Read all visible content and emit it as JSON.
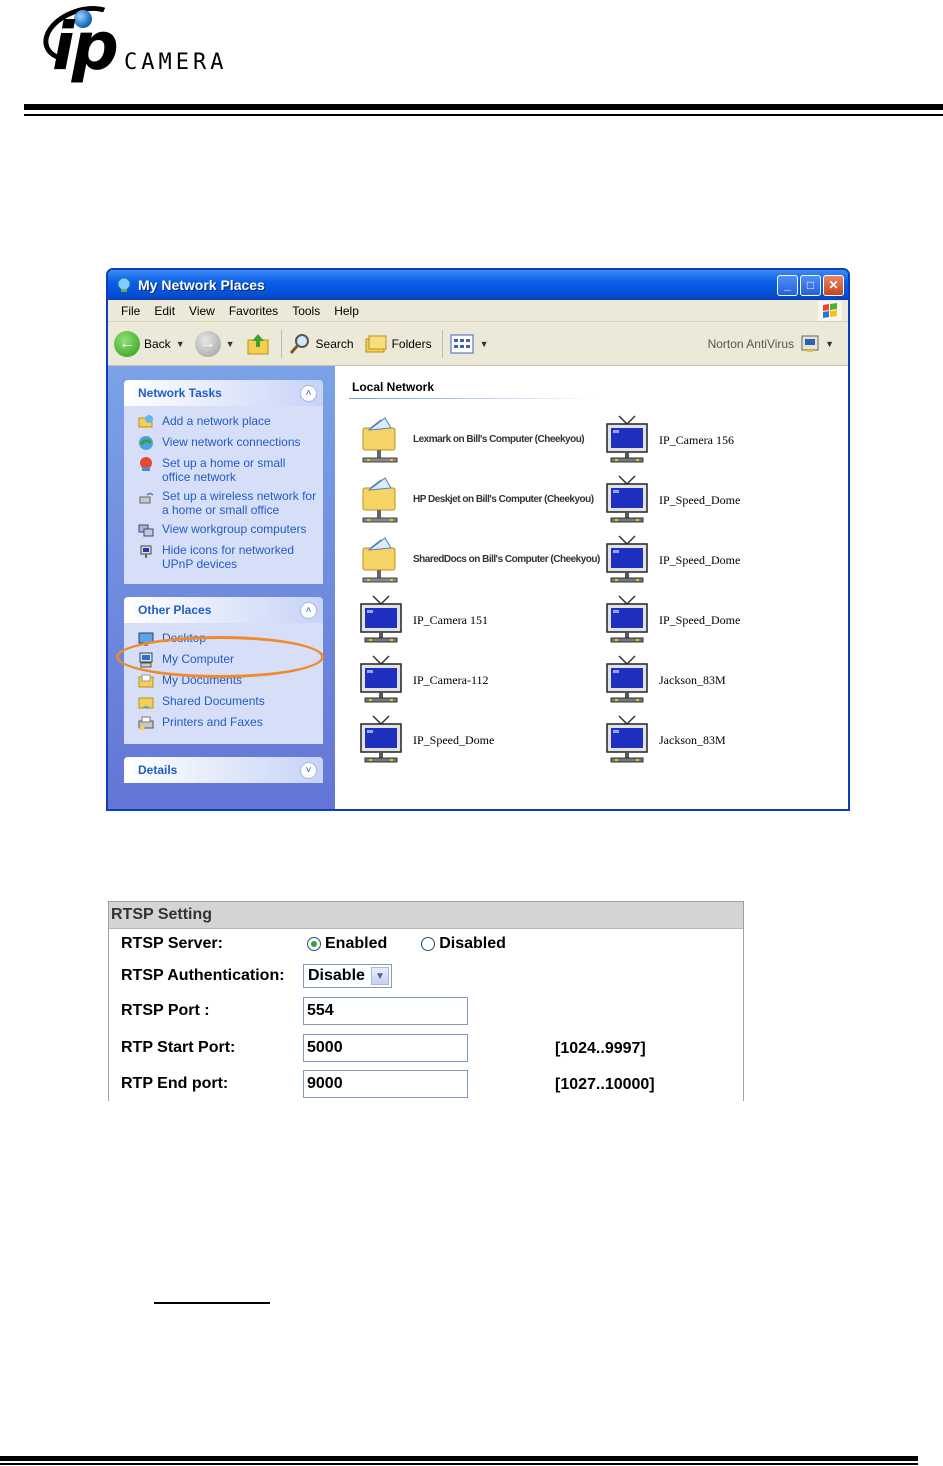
{
  "logo": {
    "mark": "ip",
    "word": "CAMERA"
  },
  "window": {
    "title": "My Network Places",
    "buttons": {
      "minimize": "_",
      "maximize": "□",
      "close": "✕"
    },
    "menu": [
      "File",
      "Edit",
      "View",
      "Favorites",
      "Tools",
      "Help"
    ],
    "toolbar": {
      "back": "Back",
      "search": "Search",
      "folders": "Folders",
      "norton": "Norton AntiVirus"
    },
    "network_tasks": {
      "title": "Network Tasks",
      "items": [
        {
          "label": "Add a network place",
          "icon": "add-network-place-icon"
        },
        {
          "label": "View network connections",
          "icon": "network-connections-icon"
        },
        {
          "label": "Set up a home or small office network",
          "icon": "home-network-icon"
        },
        {
          "label": "Set up a wireless network for a home or small office",
          "icon": "wireless-network-icon"
        },
        {
          "label": "View workgroup computers",
          "icon": "workgroup-computers-icon"
        },
        {
          "label": "Hide icons for networked UPnP devices",
          "icon": "upnp-device-icon"
        }
      ]
    },
    "other_places": {
      "title": "Other Places",
      "items": [
        {
          "label": "Desktop",
          "icon": "desktop-icon"
        },
        {
          "label": "My Computer",
          "icon": "my-computer-icon"
        },
        {
          "label": "My Documents",
          "icon": "my-documents-icon"
        },
        {
          "label": "Shared Documents",
          "icon": "shared-documents-icon"
        },
        {
          "label": "Printers and Faxes",
          "icon": "printers-icon"
        }
      ]
    },
    "details": {
      "title": "Details"
    },
    "content": {
      "group_title": "Local Network",
      "items": [
        {
          "label": "Lexmark on Bill's Computer (Cheekyou)",
          "kind": "share"
        },
        {
          "label": "IP_Camera 156",
          "kind": "camera"
        },
        {
          "label": "HP Deskjet on Bill's Computer (Cheekyou)",
          "kind": "share"
        },
        {
          "label": "IP_Speed_Dome",
          "kind": "camera"
        },
        {
          "label": "SharedDocs on Bill's Computer (Cheekyou)",
          "kind": "share"
        },
        {
          "label": "IP_Speed_Dome",
          "kind": "camera"
        },
        {
          "label": "IP_Camera 151",
          "kind": "camera"
        },
        {
          "label": "IP_Speed_Dome",
          "kind": "camera"
        },
        {
          "label": "IP_Camera-112",
          "kind": "camera"
        },
        {
          "label": "Jackson_83M",
          "kind": "camera"
        },
        {
          "label": "IP_Speed_Dome",
          "kind": "camera"
        },
        {
          "label": "Jackson_83M",
          "kind": "camera"
        }
      ]
    }
  },
  "rtsp": {
    "title": "RTSP Setting",
    "server": {
      "label": "RTSP Server:",
      "enabled": "Enabled",
      "disabled": "Disabled",
      "selected": "Enabled"
    },
    "auth": {
      "label": "RTSP Authentication:",
      "value": "Disable"
    },
    "port": {
      "label": "RTSP Port :",
      "value": "554"
    },
    "start_port": {
      "label": "RTP Start Port:",
      "value": "5000",
      "range": "[1024..9997]"
    },
    "end_port": {
      "label": "RTP End port:",
      "value": "9000",
      "range": "[1027..10000]"
    }
  },
  "colors": {
    "xp_blue": "#0a5ee6",
    "task_link": "#215dc6",
    "highlight_oval": "#ef8a2e"
  }
}
